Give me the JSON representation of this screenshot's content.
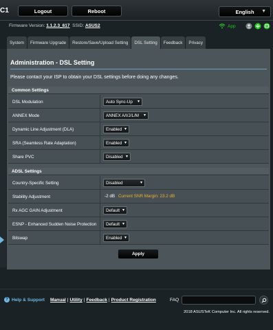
{
  "header": {
    "brand_fragment": "C1",
    "logout_label": "Logout",
    "reboot_label": "Reboot",
    "language": "English"
  },
  "info": {
    "firmware_label": "Firmware Version:",
    "firmware_value": "1.1.2.3_617",
    "ssid_label": "SSID:",
    "ssid_value": "ASUS2",
    "app_label": "App"
  },
  "tabs": [
    {
      "label": "System"
    },
    {
      "label": "Firmware Upgrade"
    },
    {
      "label": "Restore/Save/Upload Setting"
    },
    {
      "label": "DSL Setting"
    },
    {
      "label": "Feedback"
    },
    {
      "label": "Privacy"
    }
  ],
  "page": {
    "title": "Administration - DSL Setting",
    "notice": "Please contact your ISP to obtain your DSL settings before doing any changes."
  },
  "common": {
    "heading": "Common Settings",
    "rows": [
      {
        "label": "DSL Modulation",
        "value": "Auto Sync-Up"
      },
      {
        "label": "ANNEX Mode",
        "value": "ANNEX A/I/J/L/M"
      },
      {
        "label": "Dynamic Line Adjustment (DLA)",
        "value": "Enabled"
      },
      {
        "label": "SRA (Seamless Rate Adaptation)",
        "value": "Enabled"
      },
      {
        "label": "Share PVC",
        "value": "Disabled"
      }
    ]
  },
  "adsl": {
    "heading": "ADSL Settings",
    "rows": [
      {
        "label": "Country-Specific Setting",
        "value": "Disabled"
      },
      {
        "label": "Stability Adjustment",
        "value": "-2 dB",
        "extra": "Current SNR Margin: 23.2 dB"
      },
      {
        "label": "Rx AGC GAIN Adjustment",
        "value": "Default"
      },
      {
        "label": "ESNP - Enhanced Sudden Noise Protection",
        "value": "Default"
      },
      {
        "label": "Bitswap",
        "value": "Enabled"
      }
    ]
  },
  "apply_label": "Apply",
  "footer": {
    "help_label": "Help & Support",
    "links": [
      "Manual",
      "Utility",
      "Feedback",
      "Product Registration"
    ],
    "faq_label": "FAQ",
    "copyright": "2018 ASUSTeK Computer Inc. All rights reserved."
  },
  "colors": {
    "accent_blue": "#6db8e6",
    "snr_orange": "#f5b21f",
    "app_green": "#21c51d"
  }
}
